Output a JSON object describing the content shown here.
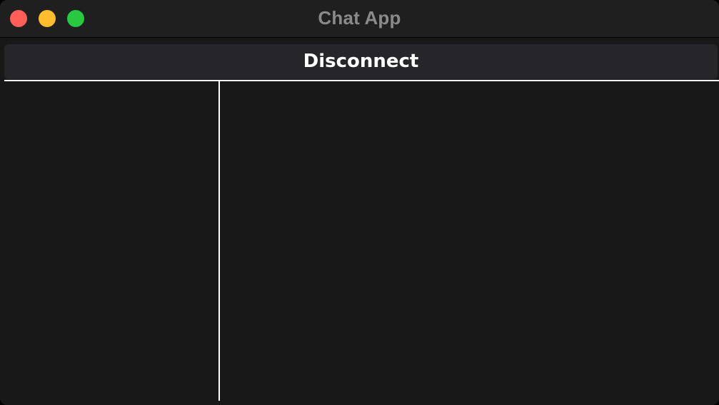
{
  "window": {
    "title": "Chat App"
  },
  "toolbar": {
    "disconnect_label": "Disconnect"
  },
  "colors": {
    "close": "#ff5f57",
    "minimize": "#febc2e",
    "zoom": "#28c840",
    "background": "#181818",
    "button": "#26262a",
    "divider": "#ffffff"
  }
}
